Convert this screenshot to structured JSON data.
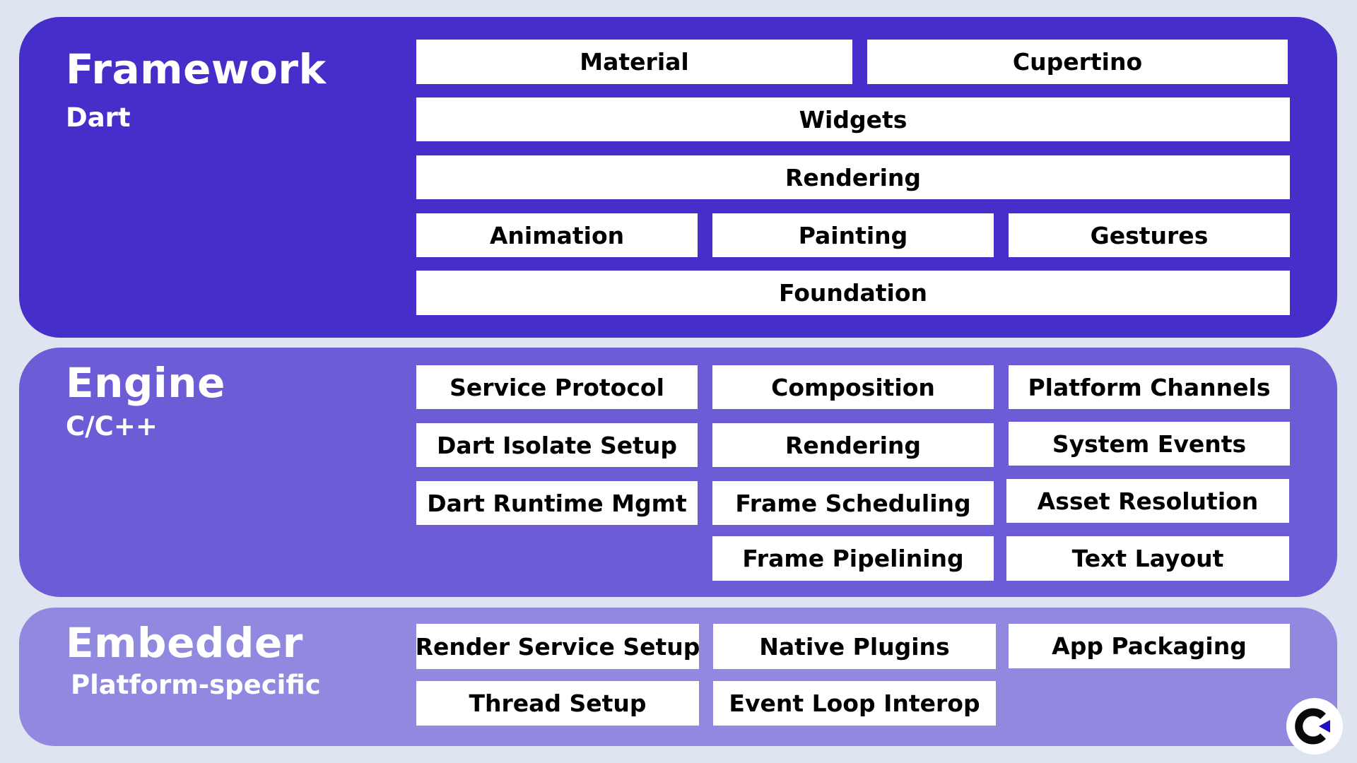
{
  "colors": {
    "background": "#DFE5F0",
    "framework_panel": "#452EC9",
    "engine_panel": "#6C5DD6",
    "embedder_panel": "#9189DF",
    "box_fill": "#FFFFFF",
    "box_text": "#000000",
    "logo_accent": "#1F0FC4"
  },
  "layers": {
    "framework": {
      "title": "Framework",
      "subtitle": "Dart",
      "components": [
        "Material",
        "Cupertino",
        "Widgets",
        "Rendering",
        "Animation",
        "Painting",
        "Gestures",
        "Foundation"
      ]
    },
    "engine": {
      "title": "Engine",
      "subtitle": "C/C++",
      "components": [
        "Service Protocol",
        "Composition",
        "Platform Channels",
        "Dart Isolate Setup",
        "Rendering",
        "System Events",
        "Dart Runtime Mgmt",
        "Frame Scheduling",
        "Asset Resolution",
        "Frame Pipelining",
        "Text Layout"
      ]
    },
    "embedder": {
      "title": "Embedder",
      "subtitle": "Platform-specific",
      "components": [
        "Render Service Setup",
        "Native Plugins",
        "App Packaging",
        "Thread Setup",
        "Event Loop Interop"
      ]
    }
  },
  "logo": {
    "icon": "c-arrow-logo-icon"
  }
}
